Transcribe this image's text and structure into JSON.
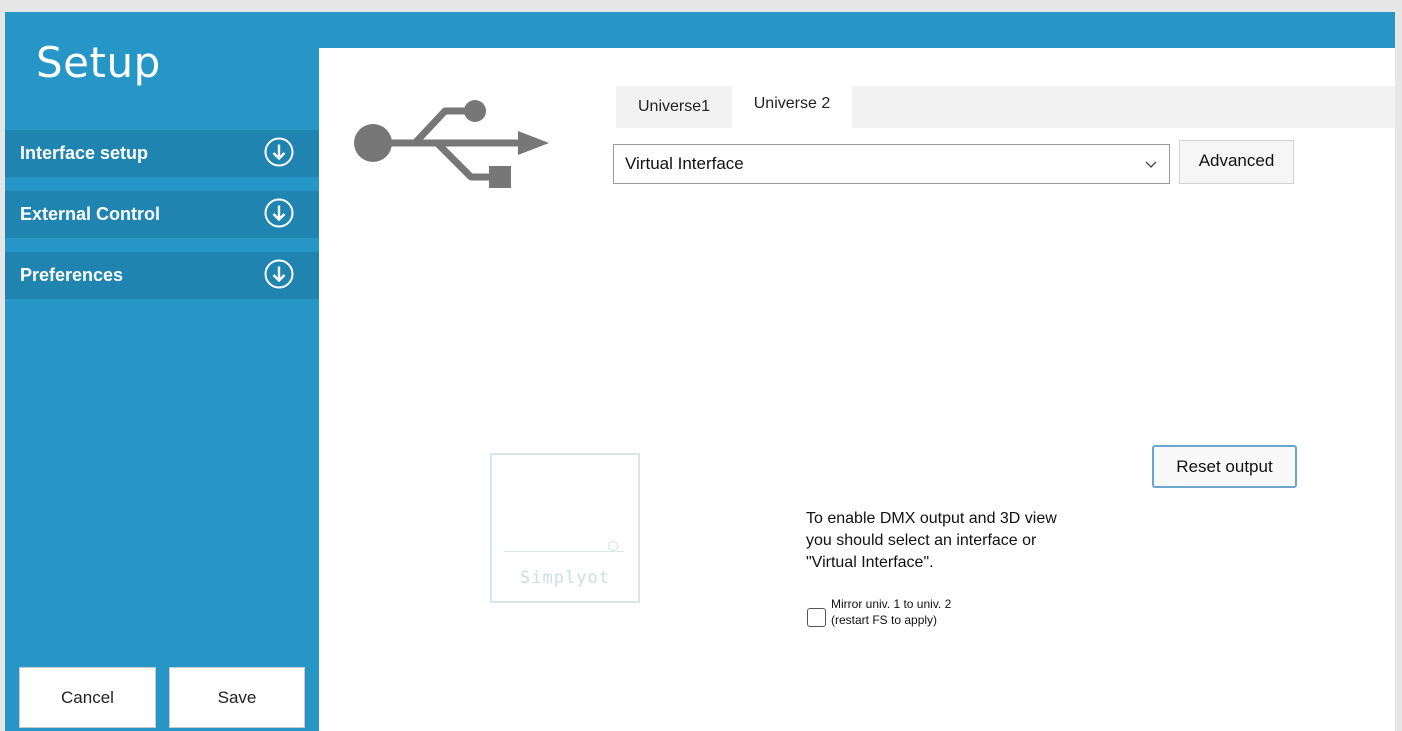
{
  "app": {
    "title": "Setup"
  },
  "sidebar": {
    "items": [
      {
        "label": "Interface setup",
        "icon": "arrow-down-circle-icon"
      },
      {
        "label": "External Control",
        "icon": "arrow-down-circle-icon"
      },
      {
        "label": "Preferences",
        "icon": "arrow-down-circle-icon"
      }
    ],
    "cancel_label": "Cancel",
    "save_label": "Save"
  },
  "main": {
    "usb_icon": "usb-icon",
    "tabs": [
      {
        "label": "Universe1",
        "active": false
      },
      {
        "label": "Universe 2",
        "active": true
      }
    ],
    "interface_select": {
      "selected": "Virtual Interface"
    },
    "advanced_label": "Advanced",
    "reset_output_label": "Reset output",
    "watermark_text": "Simplyot",
    "info_text": "To enable DMX output and 3D view\nyou should select an interface or\n\"Virtual Interface\".",
    "mirror_checkbox": {
      "checked": false,
      "label": "Mirror univ. 1 to univ. 2\n(restart FS to apply)"
    }
  },
  "colors": {
    "accent": "#2596c6",
    "sidebar_item": "#1f84b0"
  }
}
